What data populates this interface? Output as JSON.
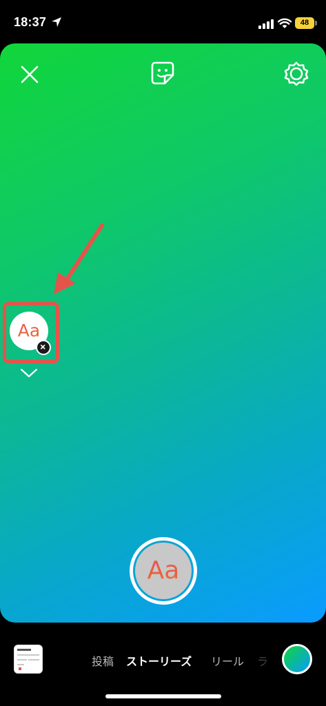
{
  "status_bar": {
    "time": "18:37",
    "battery_level": "48",
    "icons": [
      "location-arrow-icon",
      "cellular-signal-icon",
      "wifi-icon",
      "battery-icon"
    ]
  },
  "canvas": {
    "background_colors": [
      "#11d63a",
      "#0bb69a",
      "#0a9bff"
    ],
    "top_icons": [
      "close-icon",
      "sticker-icon",
      "settings-icon"
    ],
    "font_chip_label": "Aa",
    "capture_label": "Aa",
    "annotation_color": "#e5544b"
  },
  "bottom_bar": {
    "modes": [
      "投稿",
      "ストーリーズ",
      "リール",
      "ラ"
    ],
    "active_mode": "ストーリーズ",
    "icons": [
      "gallery-thumbnail",
      "color-picker-icon"
    ]
  }
}
